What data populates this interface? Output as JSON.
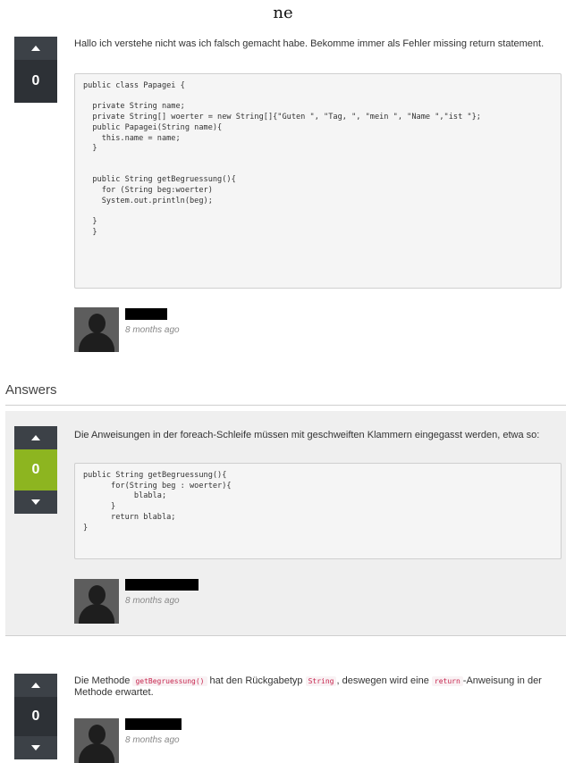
{
  "page": {
    "title": "ne"
  },
  "question": {
    "votes": "0",
    "text": "Hallo ich verstehe nicht was ich falsch gemacht habe. Bekomme immer als Fehler missing return statement.",
    "code": "public class Papagei {\n\n  private String name;\n  private String[] woerter = new String[]{\"Guten \", \"Tag, \", \"mein \", \"Name \",\"ist \"};\n  public Papagei(String name){\n    this.name = name;\n  }\n\n\n  public String getBegruessung(){\n    for (String beg:woerter)\n    System.out.println(beg);\n\n  }\n  }",
    "time": "8 months ago"
  },
  "answers_header": "Answers",
  "answers": [
    {
      "votes": "0",
      "vote_color": "#8db520",
      "text": "Die Anweisungen in der foreach-Schleife müssen mit geschweiften Klammern eingegasst werden, etwa so:",
      "code": "public String getBegruessung(){\n      for(String beg : woerter){\n           blabla;\n      }\n      return blabla;\n}",
      "time": "8 months ago"
    },
    {
      "votes": "0",
      "text_1": "Die Methode ",
      "code_1": "getBegruessung()",
      "text_2": " hat den Rückgabetyp ",
      "code_2": "String",
      "text_3": ", deswegen wird eine ",
      "code_3": "return",
      "text_4": "-Anweisung in der Methode erwartet.",
      "time": "8 months ago"
    }
  ]
}
